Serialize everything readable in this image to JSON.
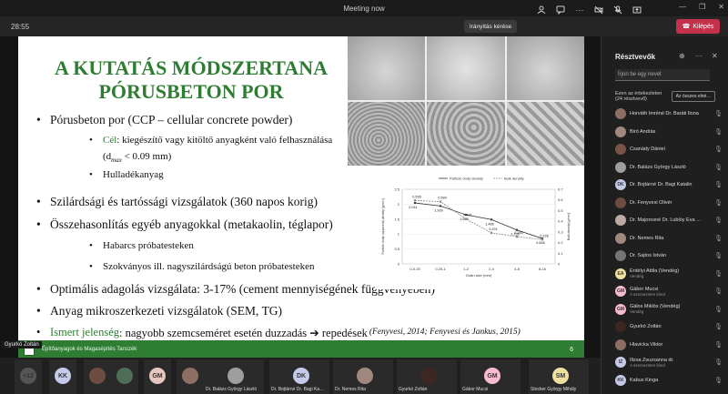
{
  "window": {
    "title": "Meeting now",
    "controls": [
      "—",
      "❐",
      "✕"
    ]
  },
  "toolbar": {
    "time": "28:55",
    "control_button": "Irányítás kérése",
    "leave_label": "Kilépés",
    "icons": [
      "people-icon",
      "chat-icon",
      "more-icon",
      "camera-off-icon",
      "mic-off-icon",
      "share-icon"
    ]
  },
  "slide": {
    "title_line1": "A KUTATÁS MÓDSZERTANA",
    "title_line2": "PÓRUSBETON POR",
    "bullets": [
      {
        "level": 1,
        "text": "Pórusbeton por (CCP – cellular concrete powder)"
      },
      {
        "level": 2,
        "green": "Cél",
        "text": ": kiegészítő vagy kitöltő anyagként való felhasználása"
      },
      {
        "level": 2,
        "text": "(d",
        "sub": "max",
        "tail": " < 0.09 mm)"
      },
      {
        "level": 2,
        "text": "Hulladékanyag"
      },
      {
        "level": 1,
        "text": "Szilárdsági és tartóssági vizsgálatok (360 napos korig)"
      },
      {
        "level": 1,
        "text": "Összehasonlítás egyéb anyagokkal (metakaolin, téglapor)"
      },
      {
        "level": 2,
        "text": "Habarcs próbatesteken"
      },
      {
        "level": 2,
        "text": "Szokványos ill. nagyszilárdságú beton próbatesteken"
      },
      {
        "level": 1,
        "text": "Optimális adagolás vizsgálata: 3-17% (cement mennyiségének függvényében)"
      },
      {
        "level": 1,
        "text": "Anyag mikroszerkezeti vizsgálatok (SEM, TG)"
      },
      {
        "level": 1,
        "green": "Ismert jelenség",
        "text": ": nagyobb szemcseméret esetén duzzadás ➔ repedések",
        "ref": " (Fenyvesi, 2014; Fenyvesi és Jankus, 2015)"
      }
    ],
    "footer_text": "Építőanyagok és Magasépítés Tanszék",
    "page_number": "6",
    "presenter_tag": "Gyurkó Zoltán"
  },
  "chart_data": {
    "type": "line",
    "categories": [
      "0-0.25",
      "0.25-1",
      "1-2",
      "2-4",
      "4-8",
      "8-16"
    ],
    "xlabel": "Grain size (mm)",
    "ylabel_left": "Particle body (apparent) density [g/cm³]",
    "ylabel_right": "Bulk density [g/cm³]",
    "ylim_left": [
      0,
      2.5
    ],
    "ylim_right": [
      0,
      0.7
    ],
    "left_ticks": [
      "0",
      "0.5",
      "1",
      "1.5",
      "2",
      "2.5"
    ],
    "right_ticks": [
      "0",
      "0.1",
      "0.2",
      "0.3",
      "0.4",
      "0.5",
      "0.6",
      "0.7"
    ],
    "legend_position": "top",
    "series": [
      {
        "name": "Particle body density",
        "axis": "left",
        "values": [
          2.041,
          1.939,
          1.645,
          1.485,
          1.136,
          0.848
        ],
        "color": "#333333"
      },
      {
        "name": "Bulk density",
        "axis": "right",
        "values": [
          0.595,
          0.584,
          0.421,
          0.291,
          0.255,
          0.228
        ],
        "color": "#888888"
      }
    ]
  },
  "strip": {
    "tiles": [
      {
        "initials": "+12",
        "name": "",
        "color": "#555555"
      },
      {
        "initials": "KK",
        "name": "",
        "color": "#c5cae9"
      },
      {
        "initials": "",
        "name": "",
        "color": "#6d4c41"
      },
      {
        "initials": "",
        "name": "",
        "color": "#4e6e58"
      },
      {
        "initials": "GM",
        "name": "",
        "color": "#e6c7c0"
      },
      {
        "initials": "",
        "name": "",
        "color": "#8d6e63"
      },
      {
        "initials": "",
        "name": "Dr. Balázs György László",
        "color": "#9e9e9e"
      },
      {
        "initials": "DK",
        "name": "Dr. Bojtárné Dr. Bagi Ka…",
        "color": "#c5cae9"
      },
      {
        "initials": "",
        "name": "Dr. Nemes Rita",
        "color": "#a1887f"
      },
      {
        "initials": "",
        "name": "Gyurkó Zoltán",
        "color": "#3e2723"
      },
      {
        "initials": "GM",
        "name": "Gábor Mucsi",
        "color": "#f8bbd0"
      },
      {
        "initials": "SM",
        "name": "Stocker György Mihály",
        "color": "#f0e0a0"
      }
    ]
  },
  "panel": {
    "title": "Résztvevők",
    "invite_placeholder": "Írjon be egy nevet",
    "waiting_label": "Ezen az értekezleten (24 résztvevő)",
    "admit_all": "Az összes elné…",
    "participants": [
      {
        "name": "Horváth Imréné Dr. Baráti Ilona",
        "sub": "",
        "initials": "",
        "color": "#8d6e63"
      },
      {
        "name": "Biró András",
        "sub": "",
        "initials": "",
        "color": "#a1887f"
      },
      {
        "name": "Csanády Dániel",
        "sub": "",
        "initials": "",
        "color": "#795548"
      },
      {
        "name": "Dr. Balázs György László",
        "sub": "",
        "initials": "",
        "color": "#9e9e9e"
      },
      {
        "name": "Dr. Bojtárné Dr. Bagi Katalin",
        "sub": "",
        "initials": "DK",
        "color": "#c5cae9"
      },
      {
        "name": "Dr. Fenyvesi Olivér",
        "sub": "",
        "initials": "",
        "color": "#6d4c41"
      },
      {
        "name": "Dr. Majorosné Dr. Lublóy Éva …",
        "sub": "",
        "initials": "",
        "color": "#bcaaa4"
      },
      {
        "name": "Dr. Nemes Rita",
        "sub": "",
        "initials": "",
        "color": "#a1887f"
      },
      {
        "name": "Dr. Sajtos István",
        "sub": "",
        "initials": "",
        "color": "#757575"
      },
      {
        "name": "Erdélyi Attila (Vendég)",
        "sub": "Vendég",
        "initials": "EA",
        "color": "#f0e0a0"
      },
      {
        "name": "Gábor Mucsi",
        "sub": "A szervezeten kívül",
        "initials": "GM",
        "color": "#f8bbd0"
      },
      {
        "name": "Gálos Miklós (Vendég)",
        "sub": "Vendég",
        "initials": "GM",
        "color": "#f8bbd0"
      },
      {
        "name": "Gyurkó Zoltán",
        "sub": "",
        "initials": "",
        "color": "#3e2723"
      },
      {
        "name": "Hlavicka Viktor",
        "sub": "",
        "initials": "",
        "color": "#8d6e63"
      },
      {
        "name": "Illzsa Zsuzsanna dr.",
        "sub": "A szervezeten kívül",
        "initials": "IZ",
        "color": "#c5cae9"
      },
      {
        "name": "Kabus Kinga",
        "sub": "",
        "initials": "KK",
        "color": "#c5cae9"
      }
    ]
  }
}
